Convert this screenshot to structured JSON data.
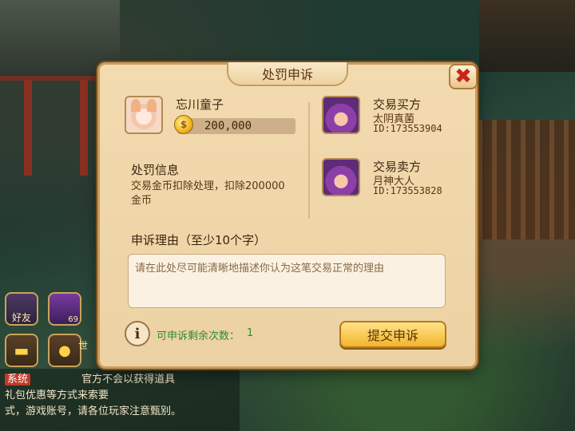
{
  "dialog": {
    "title": "处罚申诉",
    "user": {
      "name": "忘川童子",
      "coins": "200,000"
    },
    "penalty": {
      "heading": "处罚信息",
      "detail_line1": "交易金币扣除处理，扣除200000",
      "detail_line2": "金币"
    },
    "buyer": {
      "role": "交易买方",
      "name": "太阴真菌",
      "id": "ID:173553904"
    },
    "seller": {
      "role": "交易卖方",
      "name": "月神大人",
      "id": "ID:173553828"
    },
    "reason": {
      "label": "申诉理由（至少10个字）",
      "placeholder": "请在此处尽可能清晰地描述你认为这笔交易正常的理由"
    },
    "appeal_count_label": "可申诉剩余次数：",
    "appeal_count": "1",
    "submit_label": "提交申诉",
    "info_glyph": "i",
    "close_glyph": "✖"
  },
  "hud": {
    "friends_label": "好友",
    "level": "69",
    "world_label": "世"
  },
  "chat": {
    "tag": "系统",
    "line1": "官方不会以获得道具",
    "line2": "礼包优惠等方式来索要",
    "line3": "式，游戏账号，请各位玩家注意甄别。"
  },
  "colors": {
    "panel": "#ecd2a3",
    "panel_border": "#c99c5a",
    "submit_button": "#f3b52d",
    "close_x": "#c8261b",
    "count_green": "#2f8a2f"
  }
}
